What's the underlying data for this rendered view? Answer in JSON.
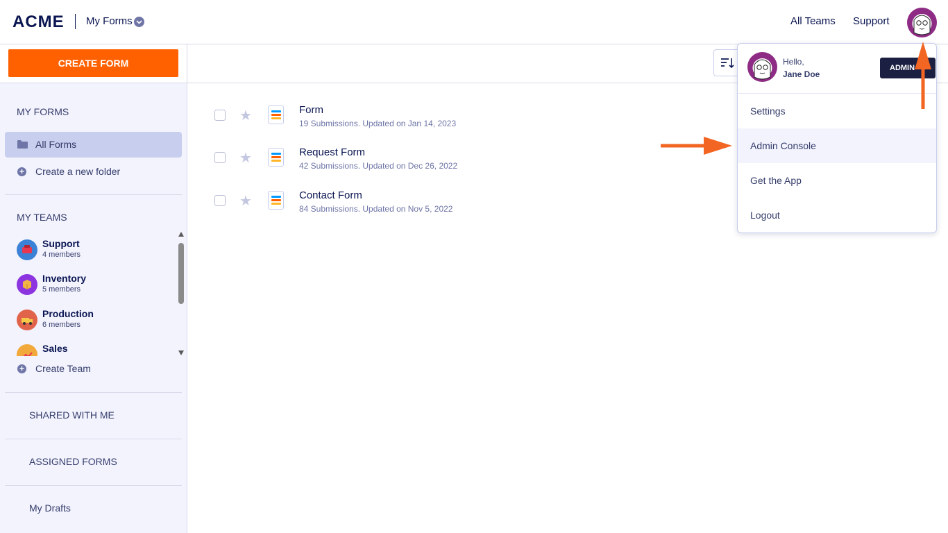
{
  "header": {
    "logo": "ACME",
    "section": "My Forms",
    "nav": [
      "All Teams",
      "Support"
    ]
  },
  "sidebar": {
    "create_button": "CREATE FORM",
    "my_forms_title": "MY FORMS",
    "all_forms": "All Forms",
    "create_folder": "Create a new folder",
    "my_teams_title": "MY TEAMS",
    "teams": [
      {
        "name": "Support",
        "members": "4 members",
        "color": "#3b82d6",
        "icon": "support-team-icon"
      },
      {
        "name": "Inventory",
        "members": "5 members",
        "color": "#8b34e0",
        "icon": "inventory-team-icon"
      },
      {
        "name": "Production",
        "members": "6 members",
        "color": "#e0634a",
        "icon": "production-team-icon"
      },
      {
        "name": "Sales",
        "members": "",
        "color": "#f2a93b",
        "icon": "sales-team-icon"
      }
    ],
    "create_team": "Create Team",
    "shared_with_me": "SHARED WITH ME",
    "assigned_forms": "ASSIGNED FORMS",
    "my_drafts": "My Drafts"
  },
  "forms": [
    {
      "title": "Form",
      "meta": "19 Submissions. Updated on Jan 14, 2023"
    },
    {
      "title": "Request Form",
      "meta": "42 Submissions. Updated on Dec 26, 2022"
    },
    {
      "title": "Contact Form",
      "meta": "84 Submissions. Updated on Nov 5, 2022"
    }
  ],
  "dropdown": {
    "greeting": "Hello,",
    "user_name": "Jane Doe",
    "badge": "ADMIN",
    "items": [
      "Settings",
      "Admin Console",
      "Get the App",
      "Logout"
    ]
  },
  "colors": {
    "accent": "#ff6100",
    "navy": "#0a1551",
    "sidebar_bg": "#f3f3fe",
    "active_item": "#c8ceed",
    "arrow": "#f26522"
  }
}
